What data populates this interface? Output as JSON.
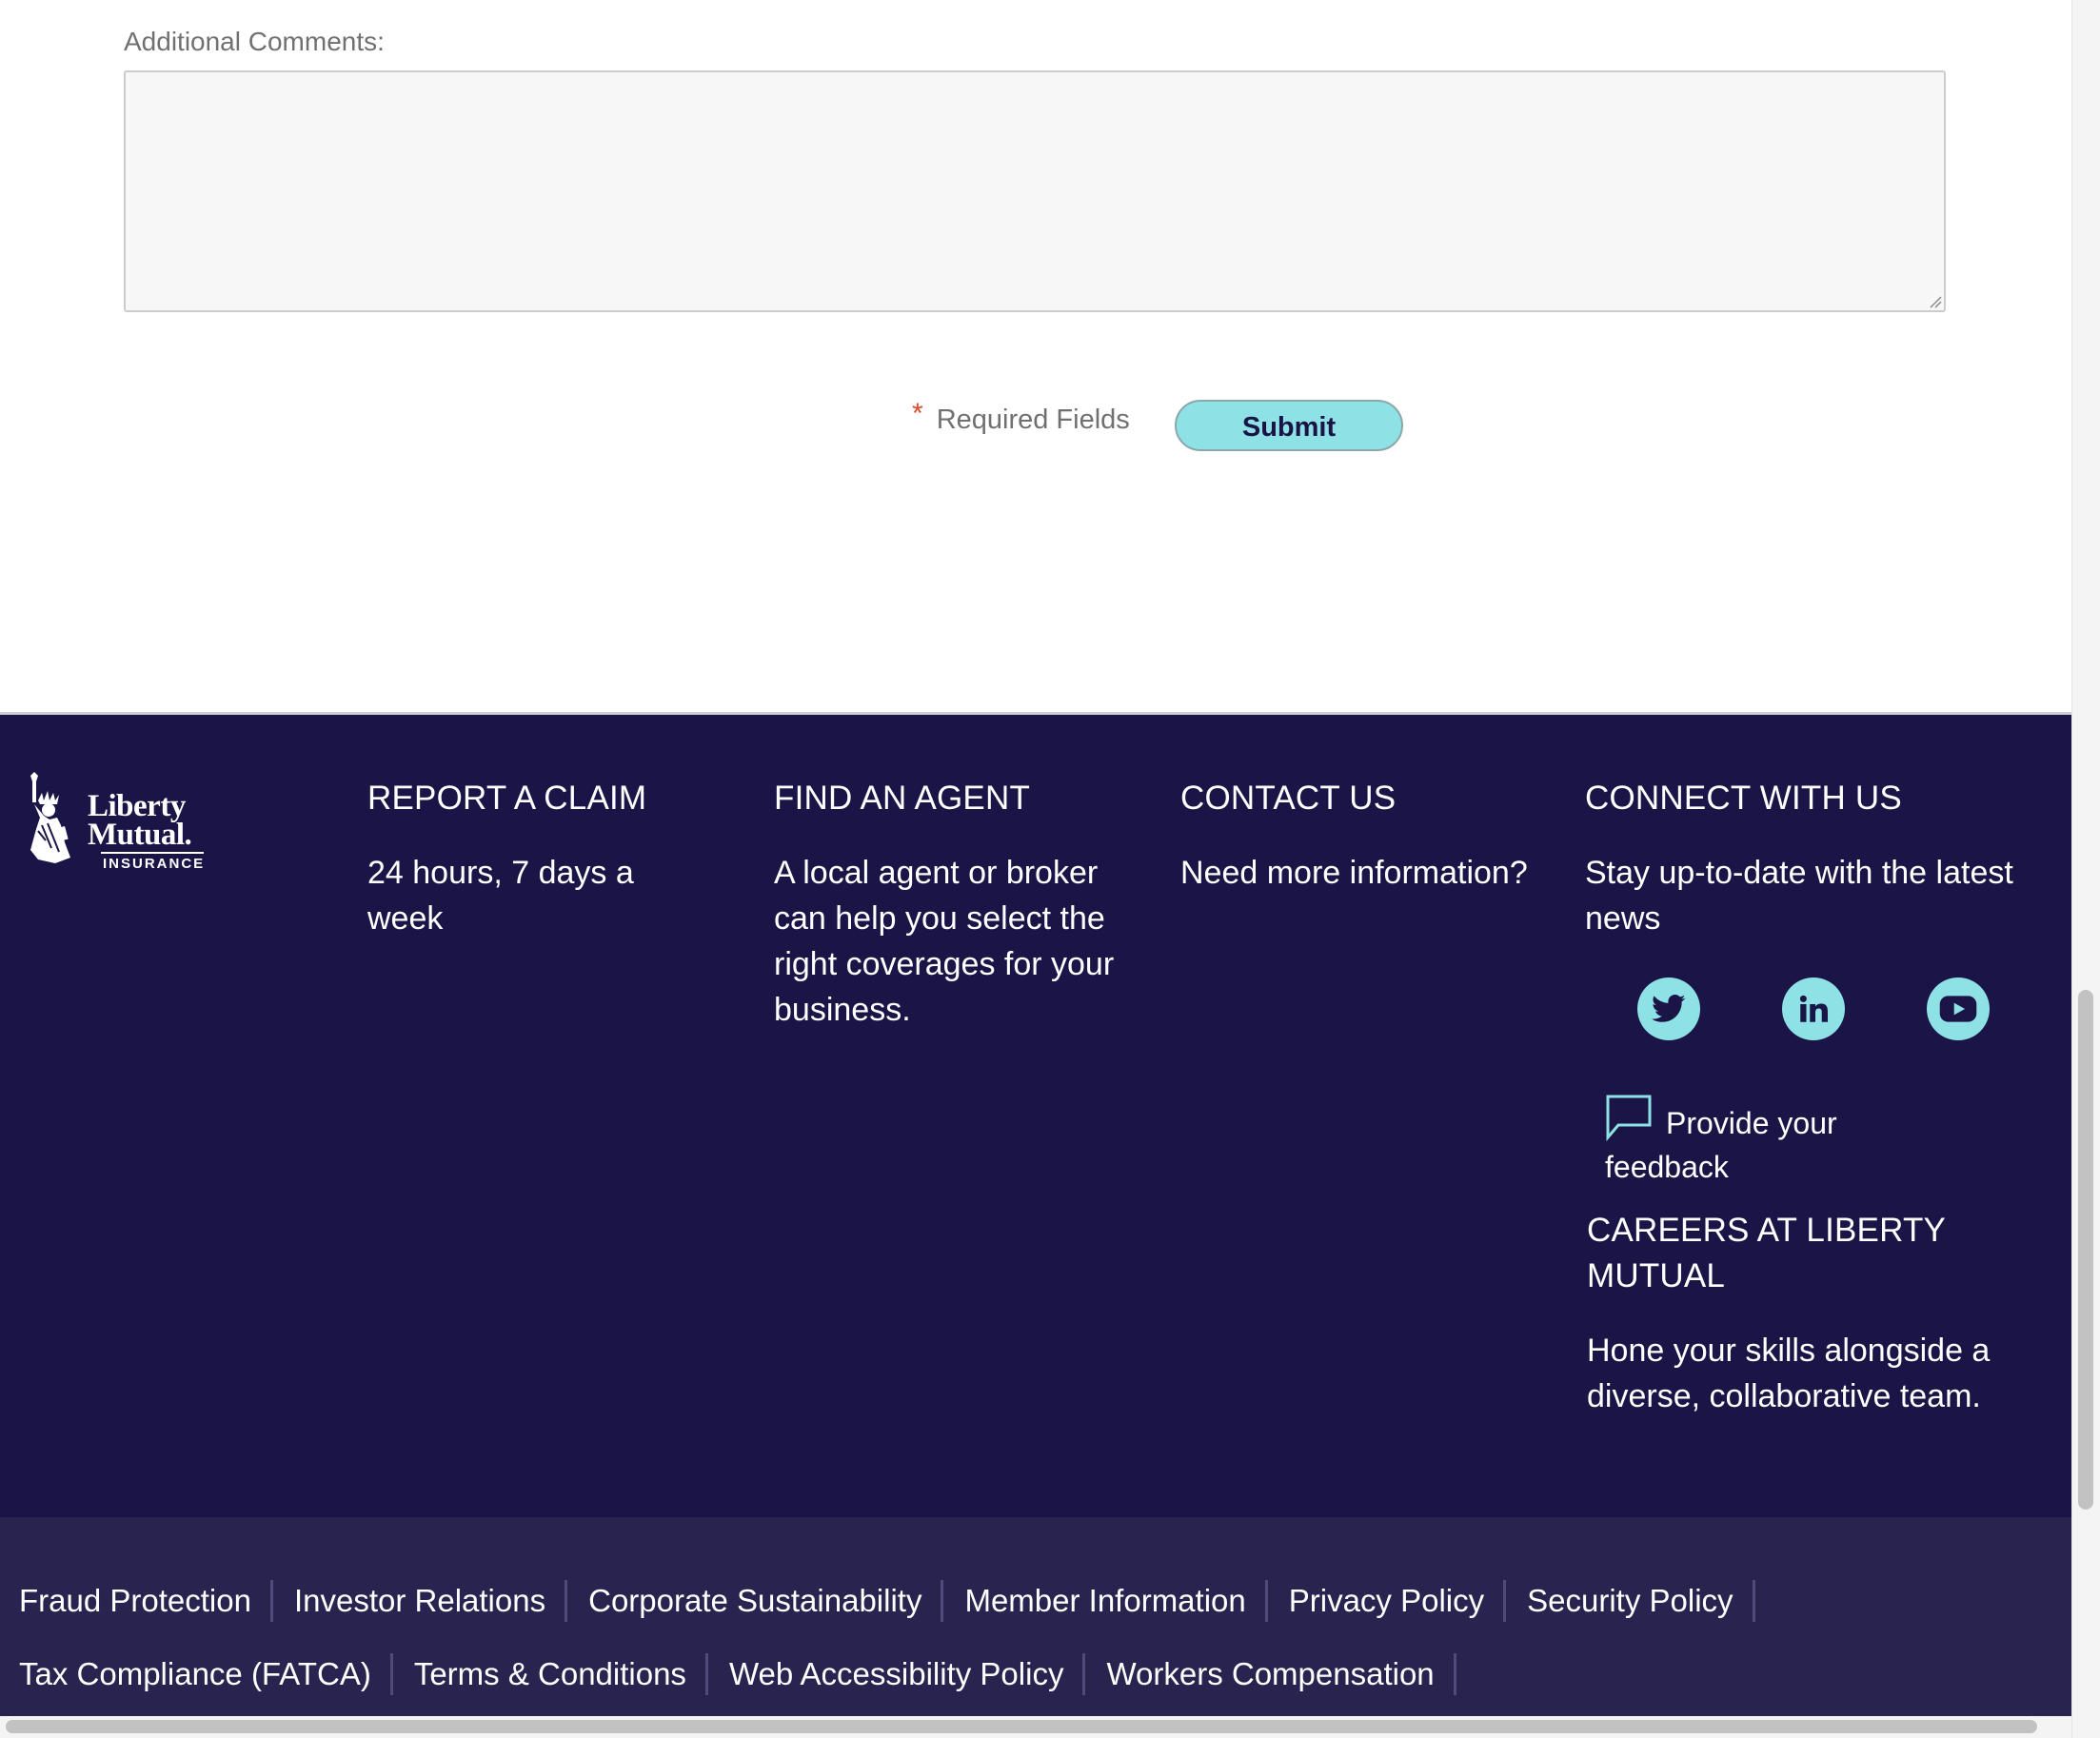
{
  "form": {
    "comments_label": "Additional Comments:",
    "comments_value": "",
    "required_star": "*",
    "required_text": "Required Fields",
    "submit_label": "Submit"
  },
  "footer": {
    "logo": {
      "line1": "Liberty",
      "line2": "Mutual.",
      "line3": "INSURANCE"
    },
    "columns": {
      "claim": {
        "heading": "REPORT A CLAIM",
        "text": "24 hours, 7 days a week"
      },
      "agent": {
        "heading": "FIND AN AGENT",
        "text": "A local agent or broker can help you select the right coverages for your business."
      },
      "contact": {
        "heading": "CONTACT US",
        "text": "Need more information?"
      },
      "connect": {
        "heading": "CONNECT WITH US",
        "text": "Stay up-to-date with the latest news"
      }
    },
    "social": [
      {
        "icon": "twitter-icon"
      },
      {
        "icon": "linkedin-icon"
      },
      {
        "icon": "youtube-icon"
      }
    ],
    "feedback_label": "Provide your feedback",
    "careers": {
      "heading": "CAREERS AT LIBERTY MUTUAL",
      "text": "Hone your skills alongside a diverse, collaborative team."
    },
    "legal_row_1": [
      "Fraud Protection",
      "Investor Relations",
      "Corporate Sustainability",
      "Member Information",
      "Privacy Policy",
      "Security Policy"
    ],
    "legal_row_2": [
      "Tax Compliance (FATCA)",
      "Terms & Conditions",
      "Web Accessibility Policy",
      "Workers Compensation"
    ]
  },
  "colors": {
    "footer_bg": "#1b1547",
    "legal_bg": "#28244f",
    "accent_teal": "#8ee2e6",
    "required_red": "#e0472b"
  }
}
